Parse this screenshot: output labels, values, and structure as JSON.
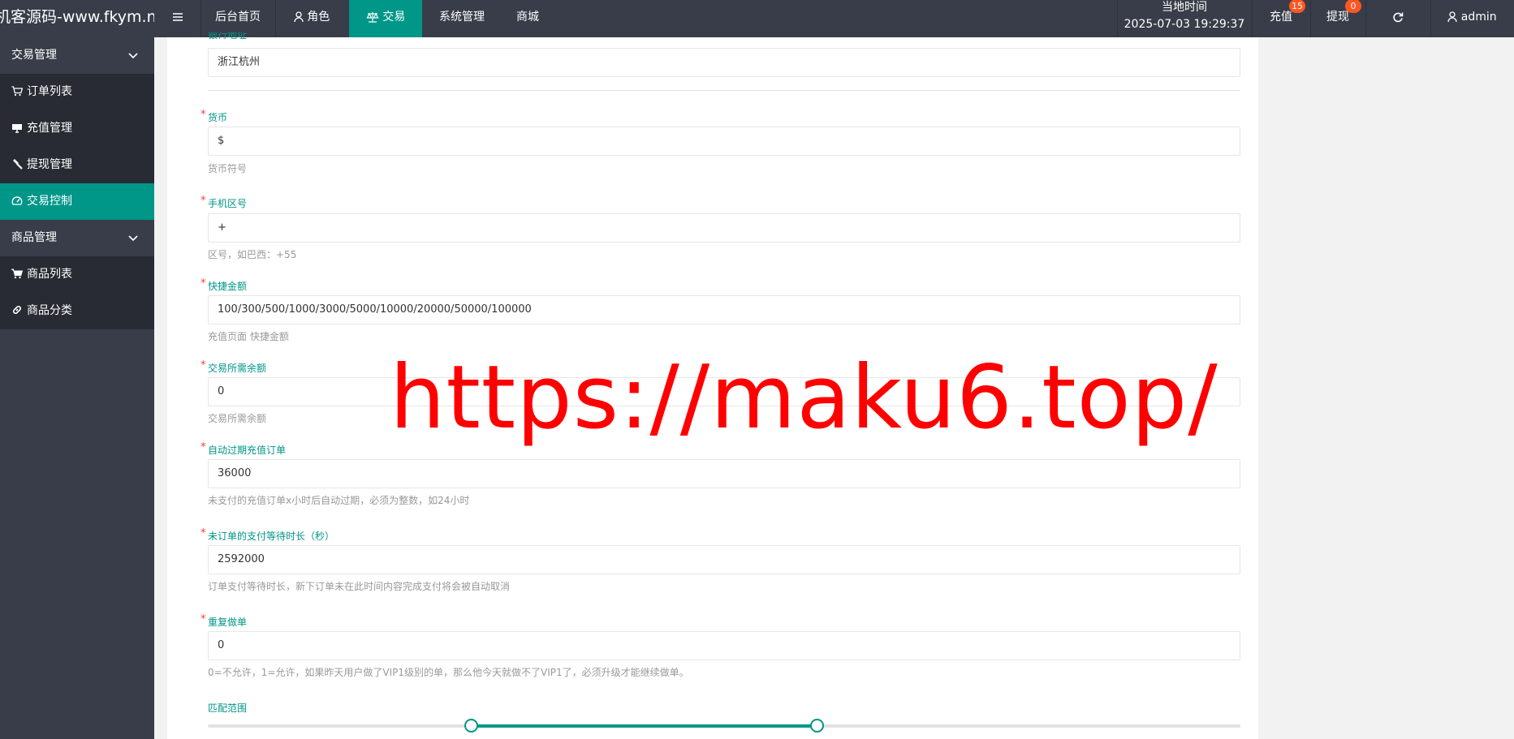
{
  "header": {
    "brand": "机客源码-www.fkym.n...",
    "nav": [
      {
        "label": "后台首页"
      },
      {
        "label": "角色"
      },
      {
        "label": "交易"
      },
      {
        "label": "系统管理"
      },
      {
        "label": "商城"
      }
    ],
    "clock_label": "当地时间",
    "clock_value": "2025-07-03 19:29:37",
    "recharge_label": "充值",
    "recharge_badge": "15",
    "withdraw_label": "提现",
    "withdraw_badge": "0",
    "user_name": "admin"
  },
  "sidebar": {
    "groups": [
      {
        "label": "交易管理",
        "items": [
          {
            "label": "订单列表",
            "icon": "cart-icon"
          },
          {
            "label": "充值管理",
            "icon": "monitor-icon"
          },
          {
            "label": "提现管理",
            "icon": "hammer-icon"
          },
          {
            "label": "交易控制",
            "icon": "gauge-icon",
            "active": true
          }
        ]
      },
      {
        "label": "商品管理",
        "items": [
          {
            "label": "商品列表",
            "icon": "cart-icon"
          },
          {
            "label": "商品分类",
            "icon": "link-icon"
          }
        ]
      }
    ]
  },
  "form": {
    "partial_label": "银行地址",
    "bank_address_value": "浙江杭州",
    "currency": {
      "label": "货币",
      "value": "$",
      "hint": "货币符号"
    },
    "phone_code": {
      "label": "手机区号",
      "value": "+",
      "hint": "区号，如巴西：+55"
    },
    "quick_amounts": {
      "label": "快捷金额",
      "value": "100/300/500/1000/3000/5000/10000/20000/50000/100000",
      "hint": "充值页面 快捷金额"
    },
    "required_balance": {
      "label": "交易所需余额",
      "value": "0",
      "hint": "交易所需余额"
    },
    "auto_expire": {
      "label": "自动过期充值订单",
      "value": "36000",
      "hint": "未支付的充值订单x小时后自动过期，必须为整数，如24小时"
    },
    "pay_wait": {
      "label": "未订单的支付等待时长（秒）",
      "value": "2592000",
      "hint": "订单支付等待时长，新下订单未在此时间内容完成支付将会被自动取消"
    },
    "repeat_order": {
      "label": "重复做单",
      "value": "0",
      "hint": "0=不允许，1=允许，如果昨天用户做了VIP1级别的单，那么他今天就做不了VIP1了，必须升级才能继续做单。"
    },
    "match_range": {
      "label": "匹配范围",
      "low": 0.255,
      "high": 0.59
    }
  },
  "watermark": "https://maku6.top/",
  "colors": {
    "accent": "#009688",
    "dark": "#393d49",
    "badge": "#ff5722",
    "required": "#ff3b3b",
    "watermark": "#ff0000"
  }
}
